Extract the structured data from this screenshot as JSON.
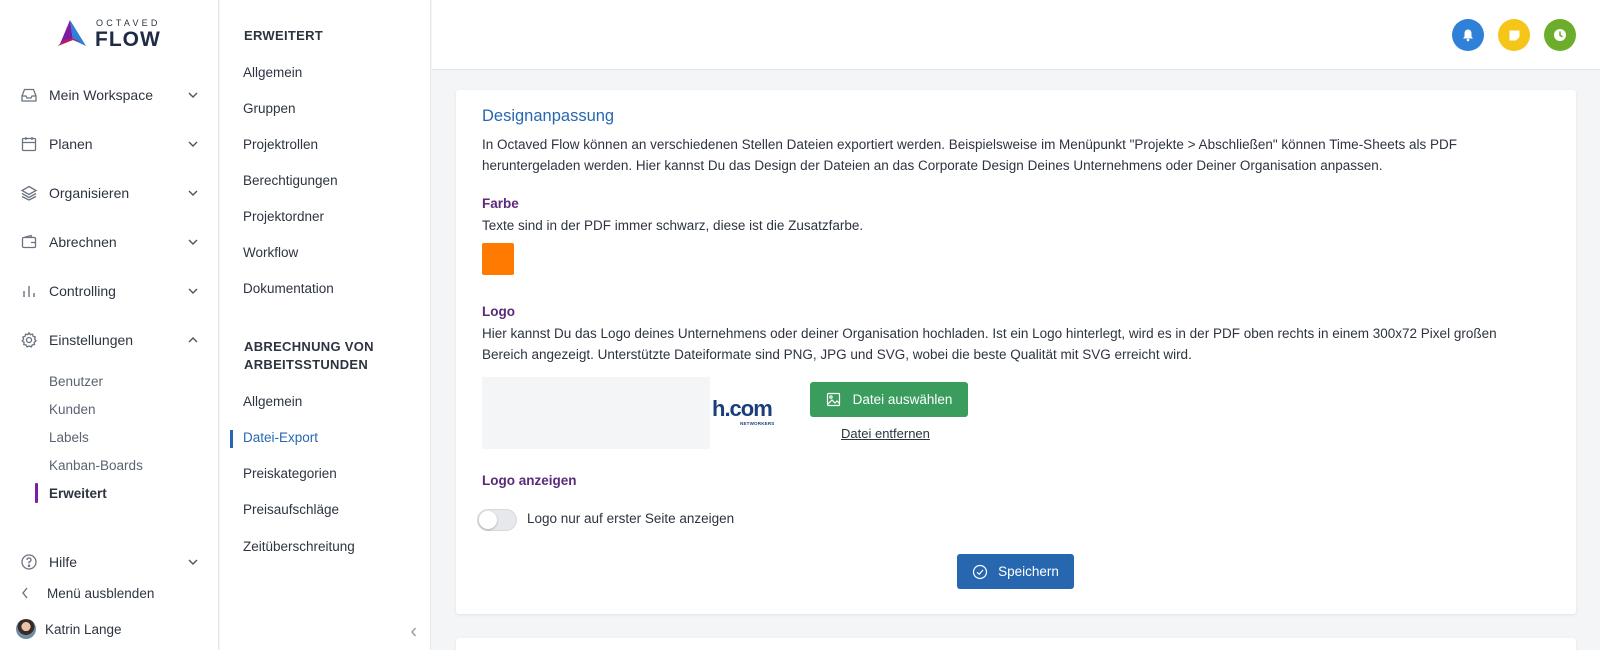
{
  "brand": {
    "small": "OCTAVED",
    "big": "FLOW"
  },
  "nav": {
    "items": [
      {
        "label": "Mein Workspace",
        "icon": "inbox-icon",
        "expanded": false
      },
      {
        "label": "Planen",
        "icon": "calendar-icon",
        "expanded": false
      },
      {
        "label": "Organisieren",
        "icon": "layers-icon",
        "expanded": false
      },
      {
        "label": "Abrechnen",
        "icon": "wallet-icon",
        "expanded": false
      },
      {
        "label": "Controlling",
        "icon": "bar-chart-icon",
        "expanded": false
      },
      {
        "label": "Einstellungen",
        "icon": "gear-icon",
        "expanded": true
      }
    ],
    "settings_sub": [
      "Benutzer",
      "Kunden",
      "Labels",
      "Kanban-Boards",
      "Erweitert"
    ],
    "settings_active": "Erweitert",
    "help_label": "Hilfe",
    "collapse_label": "Menü ausblenden",
    "user_name": "Katrin Lange",
    "accent_color": "#7b1fa2"
  },
  "subnav": {
    "section1_title": "ERWEITERT",
    "section1_items": [
      "Allgemein",
      "Gruppen",
      "Projektrollen",
      "Berechtigungen",
      "Projektordner",
      "Workflow",
      "Dokumentation"
    ],
    "section2_title_line1": "ABRECHNUNG VON",
    "section2_title_line2": "ARBEITSSTUNDEN",
    "section2_items": [
      "Allgemein",
      "Datei-Export",
      "Preiskategorien",
      "Preisaufschläge",
      "Zeitüberschreitung"
    ],
    "active": "Datei-Export",
    "active_color": "#2767b0"
  },
  "topbar": {
    "buttons": [
      {
        "icon": "bell-icon",
        "color": "#2f80d7"
      },
      {
        "icon": "sticky-note-icon",
        "color": "#f5c518"
      },
      {
        "icon": "clock-icon",
        "color": "#6cae2a"
      }
    ]
  },
  "design": {
    "title": "Designanpassung",
    "intro_line1": "In Octaved Flow können an verschiedenen Stellen Dateien exportiert werden. Beispielsweise im Menüpunkt \"Projekte > Abschließen\" können Time-Sheets als PDF",
    "intro_line2": "heruntergeladen werden. Hier kannst Du das Design der Dateien an das Corporate Design Deines Unternehmens oder Deiner Organisation anpassen.",
    "color_label": "Farbe",
    "color_desc": "Texte sind in der PDF immer schwarz, diese ist die Zusatzfarbe.",
    "color_value": "#ff7a00",
    "logo_label": "Logo",
    "logo_desc_line1": "Hier kannst Du das Logo deines Unternehmens oder deiner Organisation hochladen. Ist ein Logo hinterlegt, wird es in der PDF oben rechts in einem 300x72 Pixel großen",
    "logo_desc_line2": "Bereich angezeigt. Unterstützte Dateiformate sind PNG, JPG und SVG, wobei die beste Qualität mit SVG erreicht wird.",
    "logo_preview_text": "h.com",
    "logo_preview_sub": "NETWORKERS",
    "choose_file_label": "Datei auswählen",
    "remove_file_label": "Datei entfernen",
    "show_logo_label": "Logo anzeigen",
    "toggle_label": "Logo nur auf erster Seite anzeigen",
    "toggle_on": false,
    "save_label": "Speichern"
  }
}
